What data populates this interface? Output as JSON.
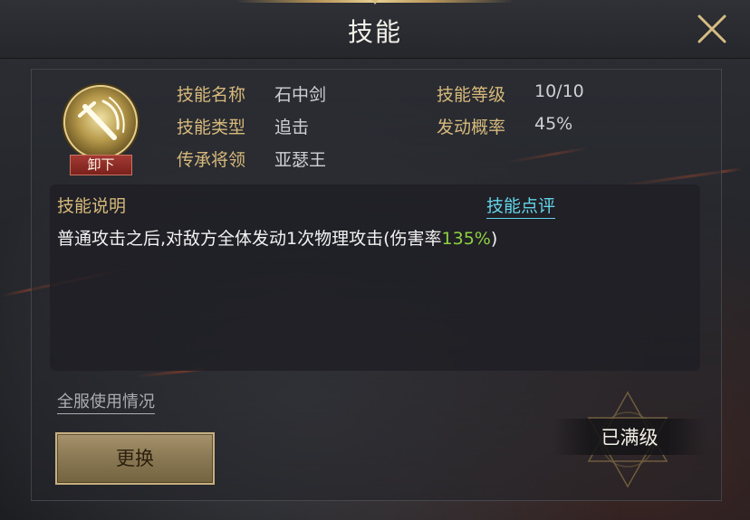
{
  "dialog": {
    "title": "技能"
  },
  "skill": {
    "unequip_label": "卸下",
    "fields": {
      "name_label": "技能名称",
      "name_value": "石中剑",
      "type_label": "技能类型",
      "type_value": "追击",
      "general_label": "传承将领",
      "general_value": "亚瑟王",
      "level_label": "技能等级",
      "level_value": "10/10",
      "chance_label": "发动概率",
      "chance_value": "45%"
    }
  },
  "description": {
    "label": "技能说明",
    "review_link": "技能点评",
    "text_before": "普通攻击之后,对敌方全体发动1次物理攻击(伤害率",
    "highlight": "135%",
    "text_after": ")",
    "highlight_color": "#8fd13f"
  },
  "footer": {
    "server_usage_link": "全服使用情况",
    "replace_button": "更换",
    "maxed_label": "已满级"
  },
  "icons": {
    "close": "close-icon",
    "skill": "sword-skill-icon",
    "maxed_emblem": "star-emblem-icon"
  },
  "colors": {
    "label_gold": "#d6b97b",
    "link_cyan": "#63d3e8",
    "unequip_red": "#8e2a24"
  }
}
